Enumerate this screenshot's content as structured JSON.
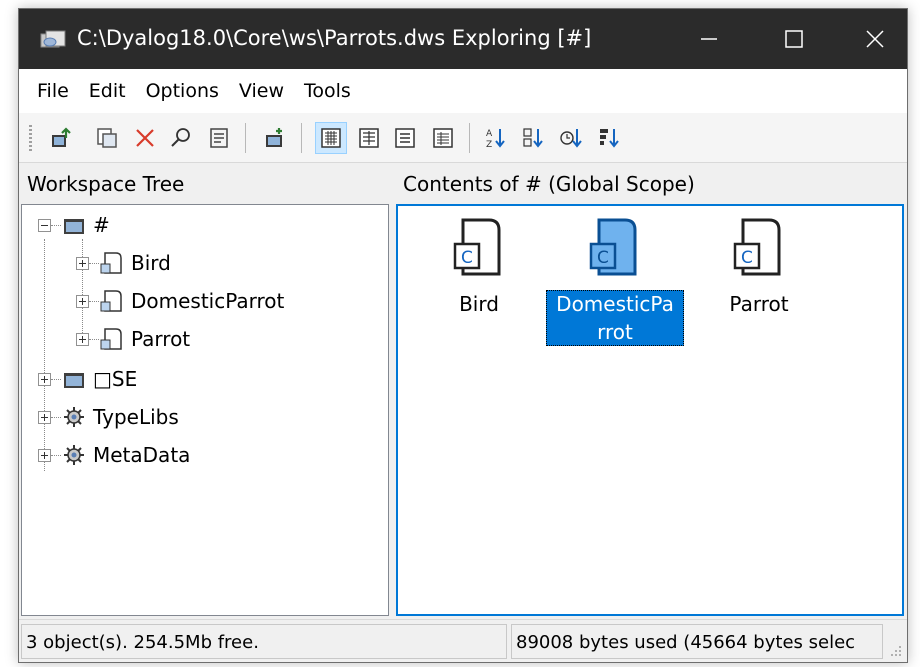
{
  "window": {
    "title": "C:\\Dyalog18.0\\Core\\ws\\Parrots.dws Exploring [#]",
    "controls": [
      "minimize",
      "maximize",
      "close"
    ]
  },
  "menu": {
    "items": [
      "File",
      "Edit",
      "Options",
      "View",
      "Tools"
    ]
  },
  "toolbar": {
    "buttons": [
      "up-level-icon",
      "copy-namespace-icon",
      "delete-icon",
      "find-icon",
      "properties-icon",
      "new-namespace-icon",
      "large-icons-view-icon",
      "small-icons-view-icon",
      "list-view-icon",
      "details-view-icon",
      "sort-by-name-icon",
      "sort-by-type-icon",
      "sort-by-date-icon",
      "sort-by-size-icon"
    ],
    "active_view": "large-icons-view"
  },
  "left_pane": {
    "header": "Workspace Tree",
    "tree": {
      "root": {
        "label": "#",
        "expanded": true
      },
      "children": [
        {
          "label": "Bird"
        },
        {
          "label": "DomesticParrot"
        },
        {
          "label": "Parrot"
        }
      ],
      "siblings": [
        {
          "label": "□SE"
        },
        {
          "label": "TypeLibs"
        },
        {
          "label": "MetaData"
        }
      ]
    }
  },
  "right_pane": {
    "header": "Contents of # (Global Scope)",
    "items": [
      {
        "line1": "Bird",
        "line2": "",
        "selected": false
      },
      {
        "line1": "DomesticPa",
        "line2": "rrot",
        "selected": true
      },
      {
        "line1": "Parrot",
        "line2": "",
        "selected": false
      }
    ]
  },
  "statusbar": {
    "left": "3 object(s). 254.5Mb free.",
    "right": "89008 bytes used (45664 bytes selec"
  },
  "colors": {
    "titlebar": "#2b2b2b",
    "selection": "#0078d7",
    "pane_border_focus": "#0078d7"
  }
}
